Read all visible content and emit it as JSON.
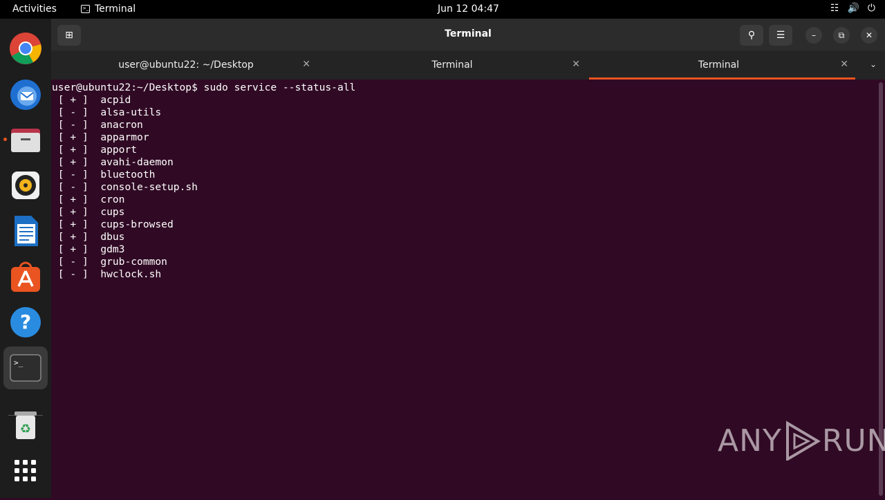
{
  "topbar": {
    "activities": "Activities",
    "app_name": "Terminal",
    "clock": "Jun 12  04:47"
  },
  "window": {
    "title": "Terminal",
    "tabs": [
      {
        "label": "user@ubuntu22: ~/Desktop",
        "active": false
      },
      {
        "label": "Terminal",
        "active": false
      },
      {
        "label": "Terminal",
        "active": true
      }
    ]
  },
  "terminal": {
    "prompt": "user@ubuntu22:~/Desktop$",
    "command": "sudo service --status-all",
    "services": [
      {
        "status": "+",
        "name": "acpid"
      },
      {
        "status": "-",
        "name": "alsa-utils"
      },
      {
        "status": "-",
        "name": "anacron"
      },
      {
        "status": "+",
        "name": "apparmor"
      },
      {
        "status": "+",
        "name": "apport"
      },
      {
        "status": "+",
        "name": "avahi-daemon"
      },
      {
        "status": "-",
        "name": "bluetooth"
      },
      {
        "status": "-",
        "name": "console-setup.sh"
      },
      {
        "status": "+",
        "name": "cron"
      },
      {
        "status": "+",
        "name": "cups"
      },
      {
        "status": "+",
        "name": "cups-browsed"
      },
      {
        "status": "+",
        "name": "dbus"
      },
      {
        "status": "+",
        "name": "gdm3"
      },
      {
        "status": "-",
        "name": "grub-common"
      },
      {
        "status": "-",
        "name": "hwclock.sh"
      }
    ]
  },
  "watermark": {
    "left": "ANY",
    "right": "RUN"
  },
  "colors": {
    "terminal_bg": "#300a24",
    "accent": "#e95420"
  }
}
